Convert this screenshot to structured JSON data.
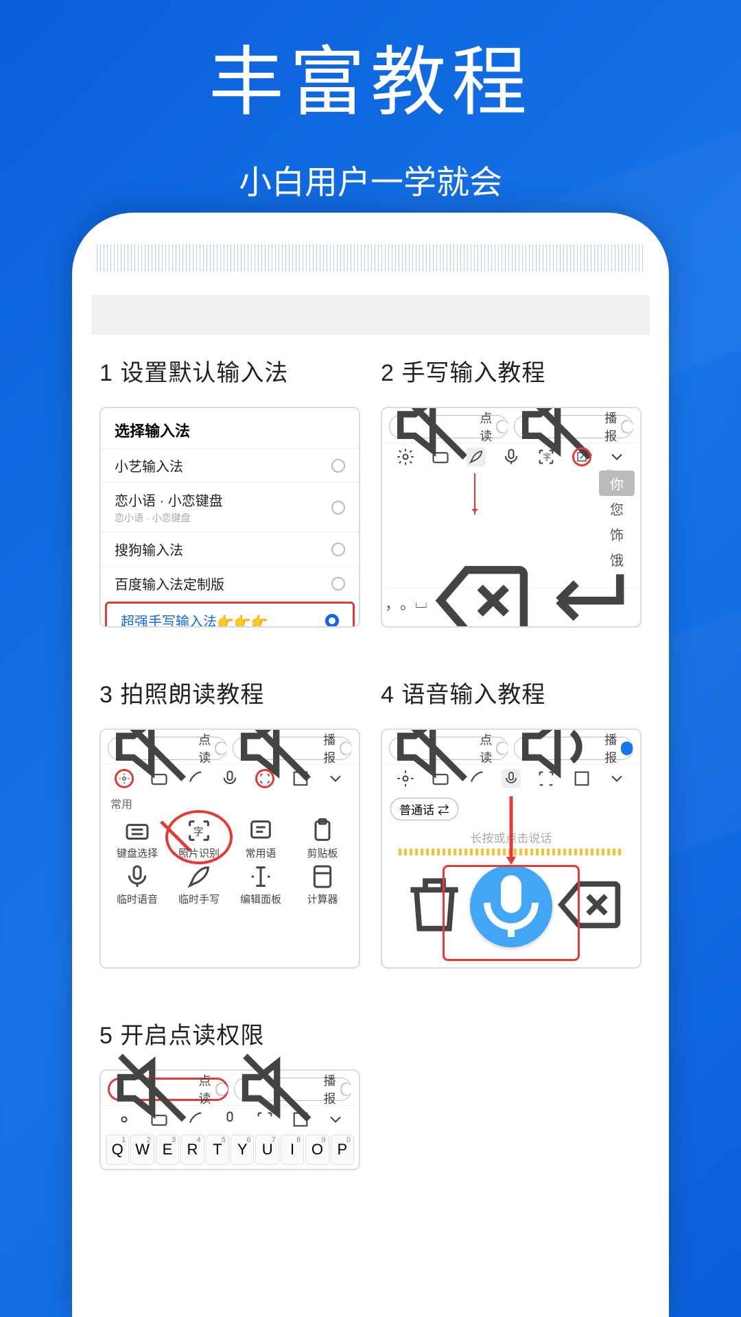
{
  "header": {
    "title": "丰富教程",
    "subtitle": "小白用户一学就会"
  },
  "tutorials": [
    {
      "num": "1",
      "title": "设置默认输入法"
    },
    {
      "num": "2",
      "title": "手写输入教程"
    },
    {
      "num": "3",
      "title": "拍照朗读教程"
    },
    {
      "num": "4",
      "title": "语音输入教程"
    },
    {
      "num": "5",
      "title": "开启点读权限"
    }
  ],
  "shot1": {
    "heading": "选择输入法",
    "options": [
      {
        "label": "小艺输入法",
        "sub": ""
      },
      {
        "label": "恋小语 · 小恋键盘",
        "sub": "恋小语 · 小恋键盘"
      },
      {
        "label": "搜狗输入法",
        "sub": ""
      },
      {
        "label": "百度输入法定制版",
        "sub": ""
      }
    ],
    "selected": {
      "label": "超强手写输入法👉👉👉"
    }
  },
  "toggles": {
    "dianDu": "点读",
    "boBao": "播报"
  },
  "shot2": {
    "pinyin": "你: ni",
    "candidates": [
      "你",
      "您",
      "饰",
      "饿"
    ],
    "bottomSymbols": [
      "，",
      "。",
      "⌴",
      "⌫",
      "↵"
    ]
  },
  "shot3": {
    "section": "常用",
    "items": [
      {
        "name": "keyboard-select-icon",
        "label": "键盘选择"
      },
      {
        "name": "photo-ocr-icon",
        "label": "照片识别"
      },
      {
        "name": "phrases-icon",
        "label": "常用语"
      },
      {
        "name": "clipboard-icon",
        "label": "剪贴板"
      },
      {
        "name": "temp-voice-icon",
        "label": "临时语音"
      },
      {
        "name": "temp-handwrite-icon",
        "label": "临时手写"
      },
      {
        "name": "edit-panel-icon",
        "label": "编辑面板"
      },
      {
        "name": "calculator-icon",
        "label": "计算器"
      }
    ]
  },
  "shot4": {
    "langPill": "普通话 ⇄",
    "hint": "长按或点击说话"
  },
  "keyboard": {
    "row": [
      "Q",
      "W",
      "E",
      "R",
      "T",
      "Y",
      "U",
      "I",
      "O",
      "P"
    ],
    "nums": [
      "1",
      "2",
      "3",
      "4",
      "5",
      "6",
      "7",
      "8",
      "9",
      "0"
    ]
  }
}
